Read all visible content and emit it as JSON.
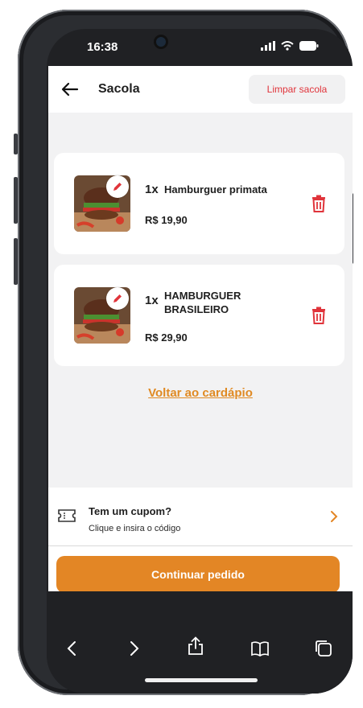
{
  "status_bar": {
    "time": "16:38"
  },
  "header": {
    "title": "Sacola",
    "clear_label": "Limpar sacola"
  },
  "cart_items": [
    {
      "qty": "1x",
      "name_line1": "Hamburguer primata",
      "name_line2": "",
      "price": "R$ 19,90"
    },
    {
      "qty": "1x",
      "name_line1": "HAMBURGUER",
      "name_line2": "BRASILEIRO",
      "price": "R$ 29,90"
    }
  ],
  "back_to_menu_label": "Voltar ao cardápio",
  "coupon": {
    "title": "Tem um cupom?",
    "subtitle": "Clique e insira o código"
  },
  "continue_label": "Continuar pedido",
  "colors": {
    "accent": "#e38625",
    "danger": "#e0343b",
    "background": "#f2f2f3"
  },
  "icons": [
    "back-arrow-icon",
    "edit-pencil-icon",
    "trash-icon",
    "ticket-icon",
    "chevron-right-icon",
    "share-icon",
    "book-icon",
    "tabs-icon"
  ]
}
